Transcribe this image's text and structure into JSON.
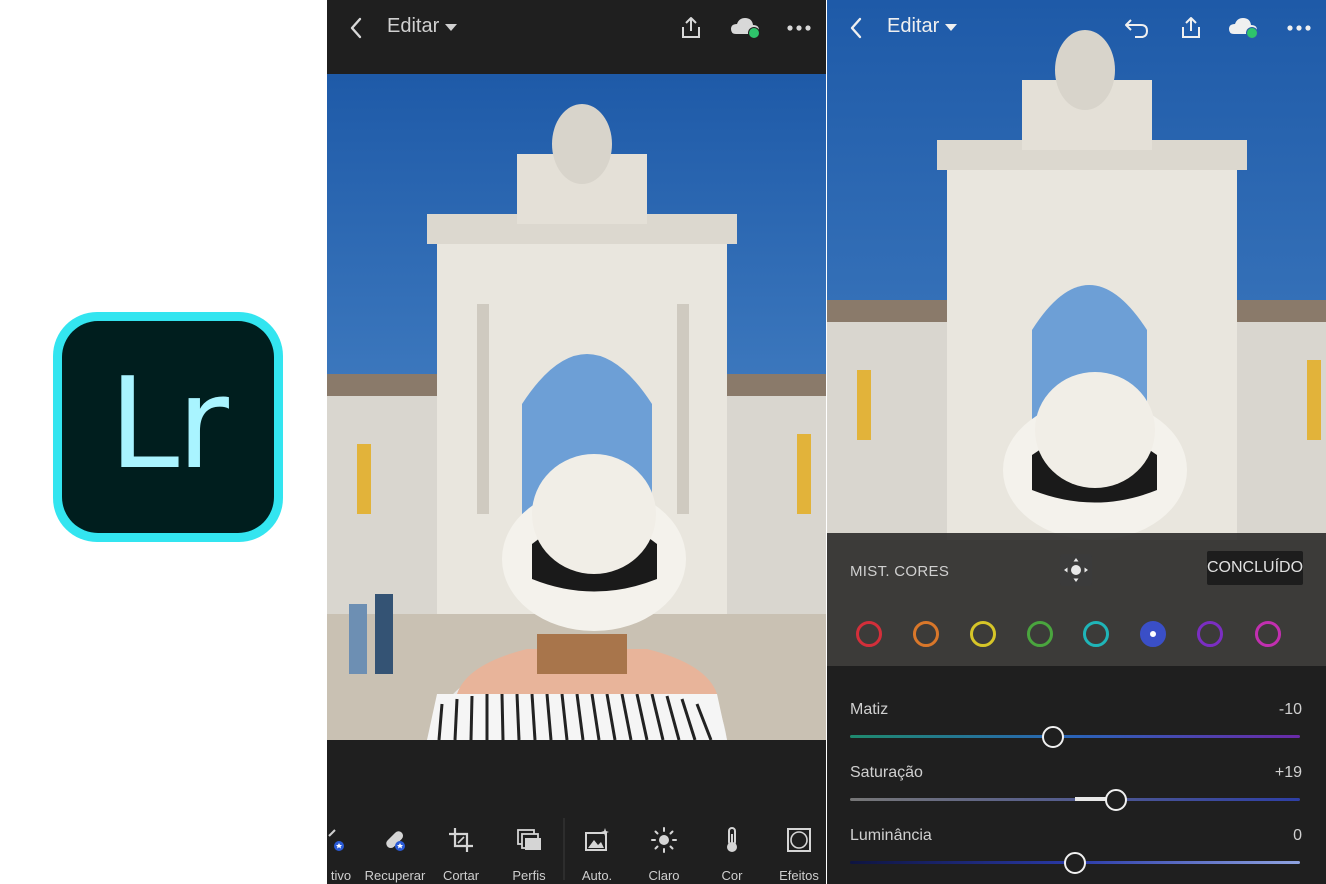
{
  "logo": {
    "text": "Lr",
    "ring_color": "#33e5f0",
    "bg_color": "#001e1e",
    "text_color": "#a9f4ff"
  },
  "left_phone": {
    "topbar": {
      "title": "Editar",
      "icons": [
        "back-chevron-icon",
        "share-icon",
        "cloud-sync-icon",
        "more-icon"
      ]
    },
    "toolbar": {
      "items": [
        {
          "label": "tivo",
          "icon": "selective-icon"
        },
        {
          "label": "Recuperar",
          "icon": "healing-icon"
        },
        {
          "label": "Cortar",
          "icon": "crop-icon"
        },
        {
          "label": "Perfis",
          "icon": "profiles-icon"
        },
        {
          "label": "Auto.",
          "icon": "auto-icon"
        },
        {
          "label": "Claro",
          "icon": "light-icon"
        },
        {
          "label": "Cor",
          "icon": "color-temperature-icon"
        },
        {
          "label": "Efeitos",
          "icon": "effects-icon"
        }
      ]
    }
  },
  "right_phone": {
    "topbar": {
      "title": "Editar",
      "icons": [
        "back-chevron-icon",
        "undo-icon",
        "share-icon",
        "cloud-sync-icon",
        "more-icon"
      ]
    },
    "color_mix": {
      "title": "MIST. CORES",
      "done_label": "CONCLUÍDO",
      "swatches": [
        {
          "name": "red",
          "color": "#d32f3a",
          "selected": false
        },
        {
          "name": "orange",
          "color": "#d9772a",
          "selected": false
        },
        {
          "name": "yellow",
          "color": "#d6c528",
          "selected": false
        },
        {
          "name": "green",
          "color": "#4aa53e",
          "selected": false
        },
        {
          "name": "aqua",
          "color": "#1fb5b8",
          "selected": false
        },
        {
          "name": "blue",
          "color": "#3a4fc7",
          "selected": true
        },
        {
          "name": "purple",
          "color": "#7b2ec2",
          "selected": false
        },
        {
          "name": "magenta",
          "color": "#c22fb0",
          "selected": false
        }
      ]
    },
    "sliders": [
      {
        "label": "Matiz",
        "value": "-10",
        "level": 0.45
      },
      {
        "label": "Saturação",
        "value": "+19",
        "level": 0.59
      },
      {
        "label": "Luminância",
        "value": "0",
        "level": 0.5
      }
    ]
  }
}
